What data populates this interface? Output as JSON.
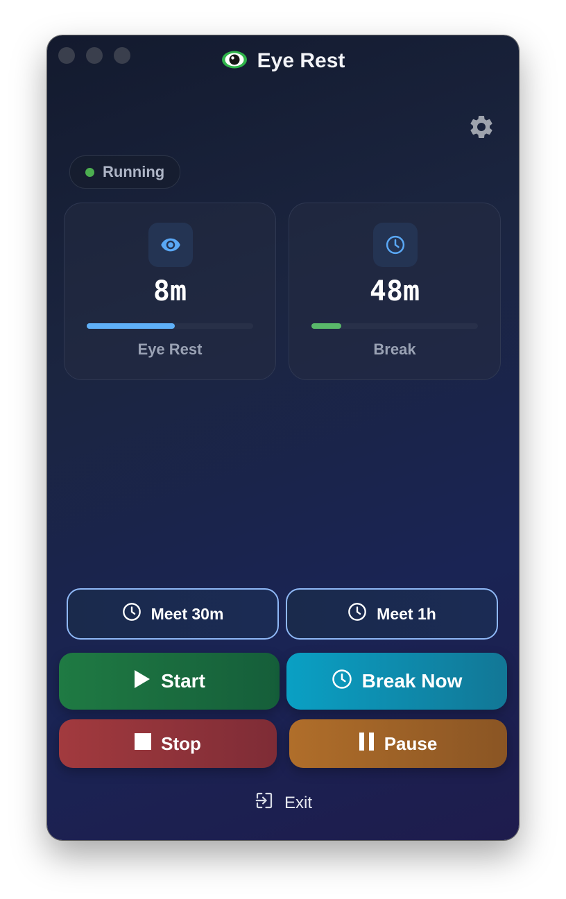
{
  "app": {
    "title": "Eye Rest",
    "logo_icon": "eye-logo-icon"
  },
  "settings": {
    "icon": "gear-icon"
  },
  "status": {
    "label": "Running",
    "color": "#4caf50"
  },
  "cards": [
    {
      "icon": "eye-icon",
      "value": "8m",
      "label": "Eye Rest",
      "progress": 0.53,
      "bar_color": "#5fb0f8"
    },
    {
      "icon": "clock-icon",
      "value": "48m",
      "label": "Break",
      "progress": 0.18,
      "bar_color": "#59b96a"
    }
  ],
  "meeting_buttons": [
    {
      "label": "Meet 30m",
      "icon": "clock-icon"
    },
    {
      "label": "Meet 1h",
      "icon": "clock-icon"
    }
  ],
  "actions": {
    "start": {
      "label": "Start",
      "icon": "play-icon"
    },
    "break_now": {
      "label": "Break Now",
      "icon": "clock-icon"
    },
    "stop": {
      "label": "Stop",
      "icon": "stop-icon"
    },
    "pause": {
      "label": "Pause",
      "icon": "pause-icon"
    }
  },
  "exit": {
    "label": "Exit",
    "icon": "exit-icon"
  }
}
